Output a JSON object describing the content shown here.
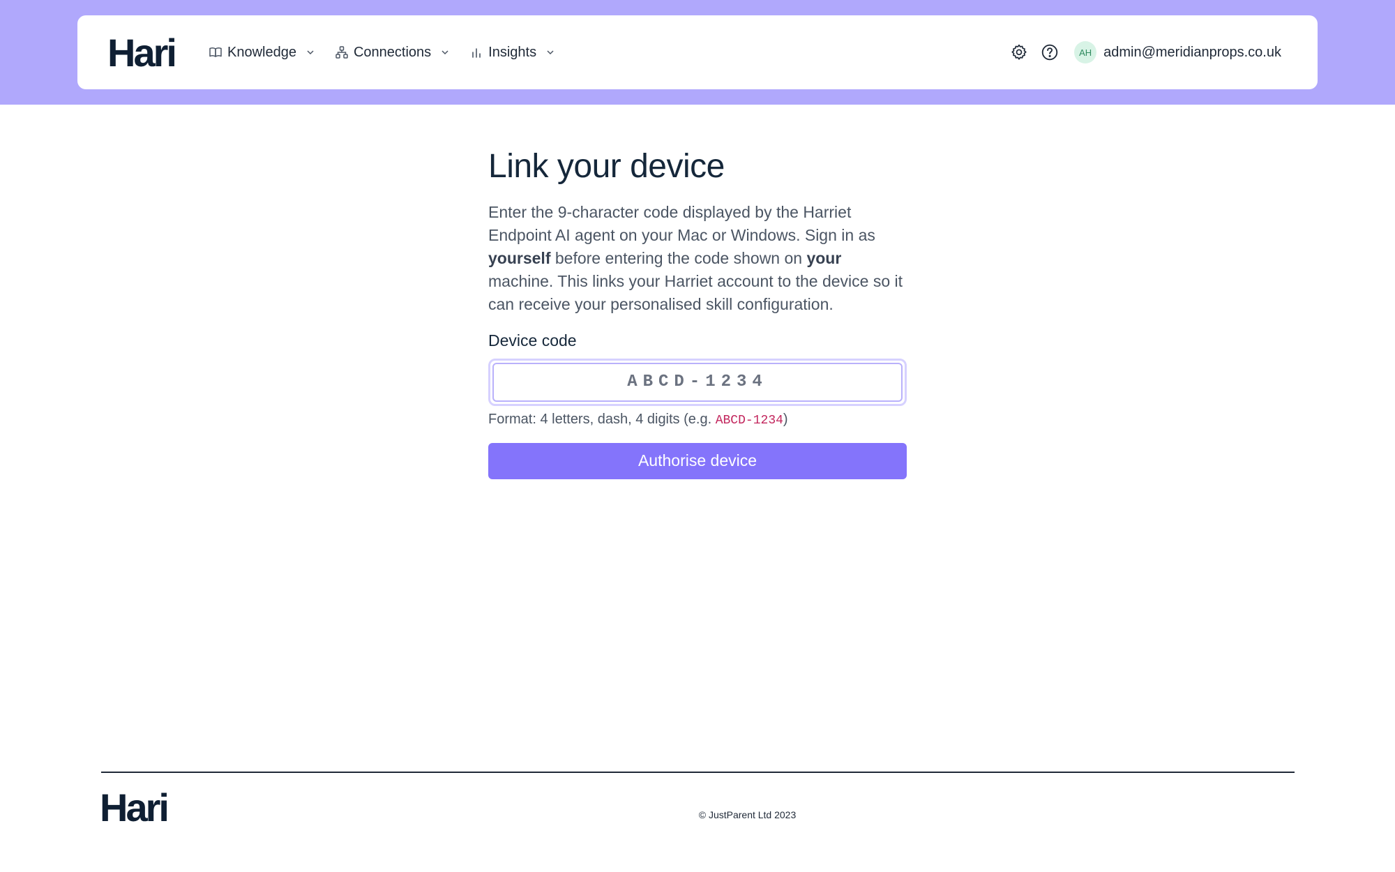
{
  "header": {
    "logo": "Hari",
    "nav": [
      {
        "label": "Knowledge",
        "icon": "book-icon"
      },
      {
        "label": "Connections",
        "icon": "network-icon"
      },
      {
        "label": "Insights",
        "icon": "bar-chart-icon"
      }
    ],
    "settings_icon": "gear-icon",
    "help_icon": "help-circle-icon",
    "avatar_initials": "AH",
    "user_email": "admin@meridianprops.co.uk"
  },
  "main": {
    "title": "Link your device",
    "description": {
      "part1": "Enter the 9-character code displayed by the Harriet Endpoint AI agent on your Mac or Windows. Sign in as ",
      "bold1": "yourself",
      "part2": " before entering the code shown on ",
      "bold2": "your",
      "part3": " machine. This links your Harriet account to the device so it can receive your personalised skill configuration."
    },
    "field_label": "Device code",
    "input_placeholder": "ABCD-1234",
    "input_value": "",
    "hint_prefix": "Format: 4 letters, dash, 4 digits (e.g. ",
    "hint_example": "ABCD-1234",
    "hint_suffix": ")",
    "submit_label": "Authorise device"
  },
  "footer": {
    "logo": "Hari",
    "copyright": "© JustParent Ltd 2023"
  },
  "colors": {
    "top_band": "#b0a8fc",
    "primary": "#8474fb",
    "text_dark": "#15273a",
    "code_accent": "#c2255c"
  }
}
